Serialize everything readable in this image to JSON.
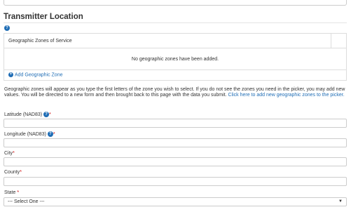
{
  "section": {
    "title": "Transmitter Location",
    "help_glyph": "?"
  },
  "zones": {
    "column_header": "Geographic Zones of Service",
    "empty_message": "No geographic zones have been added.",
    "add_label": "Add Geographic Zone",
    "add_glyph": "+"
  },
  "help": {
    "text": "Geographic zones will appear as you type the first letters of the zone you wish to select.  If you do not see the zones you need in the picker, you may add new values. You will be directed to a new form and then brought back to this page with the data you submit. ",
    "link": "Click here to add new geographic zones to the picker."
  },
  "fields": {
    "latitude": {
      "label": "Latitude (NAD83)",
      "required_mark": "*",
      "value": ""
    },
    "longitude": {
      "label": "Longitude (NAD83)",
      "required_mark": "*",
      "value": ""
    },
    "city": {
      "label": "City",
      "required_mark": "*",
      "value": ""
    },
    "county": {
      "label": "County",
      "required_mark": "*",
      "value": ""
    },
    "state": {
      "label": "State",
      "required_mark": "*",
      "selected": "--- Select One ---",
      "caret": "▼"
    }
  },
  "colors": {
    "accent": "#1f6db5",
    "required": "#cc0000",
    "border": "#cccccc"
  }
}
